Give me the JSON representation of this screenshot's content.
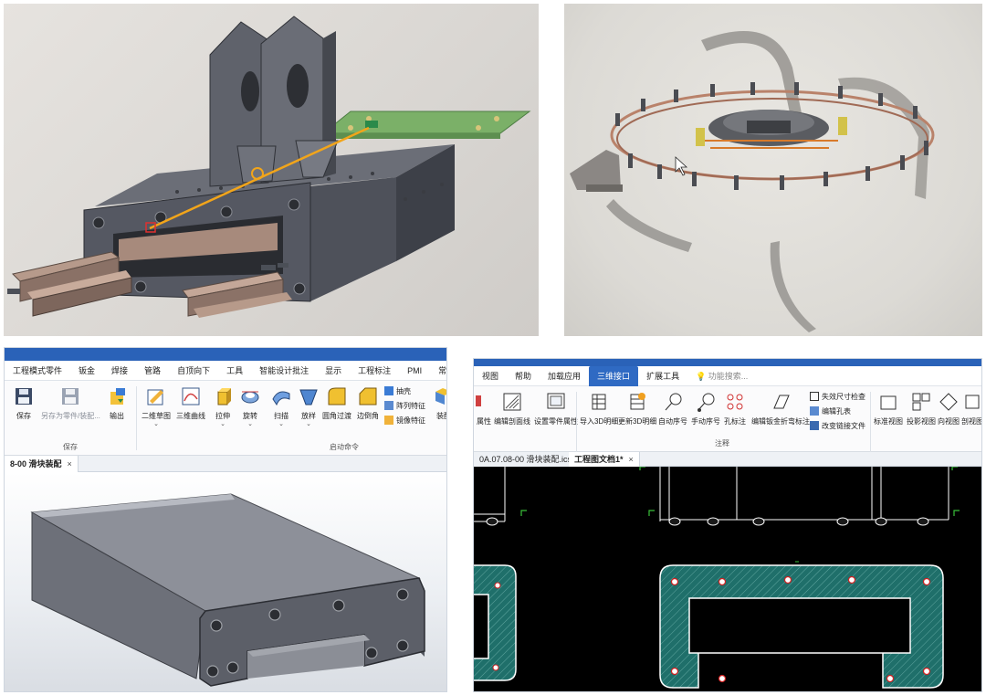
{
  "colors": {
    "ribbon_blue": "#2f6ac3",
    "title_blue": "#2a62b8",
    "part_gray": "#5c5f68",
    "hatch_teal": "#1f6f6a",
    "laser_yellow": "#f2a51a",
    "pcb_green": "#7bb068"
  },
  "panel3": {
    "menu": [
      "工程模式零件",
      "钣金",
      "焊接",
      "管路",
      "自顶向下",
      "工具",
      "智能设计批注",
      "显示",
      "工程标注",
      "PMI",
      "常"
    ],
    "buttons": {
      "save": "保存",
      "save_as": "另存为零件/装配...",
      "export": "输出",
      "sketch2d": "二维草图",
      "curve3d": "三维曲线",
      "extrude": "拉伸",
      "revolve": "旋转",
      "sweep": "扫描",
      "loft": "放样",
      "fillet": "圆角过渡",
      "chamfer": "边倒角",
      "shell": "抽壳",
      "pattern": "阵列特征",
      "mirror": "镜像特征",
      "assembly": "装配"
    },
    "groups": {
      "save": "保存",
      "launch": "启动命令"
    },
    "doc_tab": "8-00 滑块装配",
    "close": "×"
  },
  "panel4": {
    "menu": [
      "视图",
      "帮助",
      "加载应用",
      "三维接口",
      "扩展工具"
    ],
    "active_menu": "三维接口",
    "search_placeholder": "功能搜索...",
    "buttons": {
      "props": "属性",
      "edit_section": "编辑剖面线",
      "set_part_props": "设置零件属性",
      "import_bom": "导入3D明细",
      "update_bom": "更新3D明细",
      "auto_balloon": "自动序号",
      "manual_balloon": "手动序号",
      "hole_note": "孔标注",
      "sheet_bend": "编辑钣金折弯标注",
      "dim_check": "失效尺寸检查",
      "hole_table": "编辑孔表",
      "change_link": "改变链接文件",
      "std_view": "标准视图",
      "proj_view": "投影视图",
      "dir_view": "向视图",
      "sect_view": "剖视图"
    },
    "groups": {
      "annotate": "注释"
    },
    "tabs": [
      "0A.07.08-00 滑块装配.ics*",
      "工程图文档1*"
    ],
    "close": "×"
  }
}
